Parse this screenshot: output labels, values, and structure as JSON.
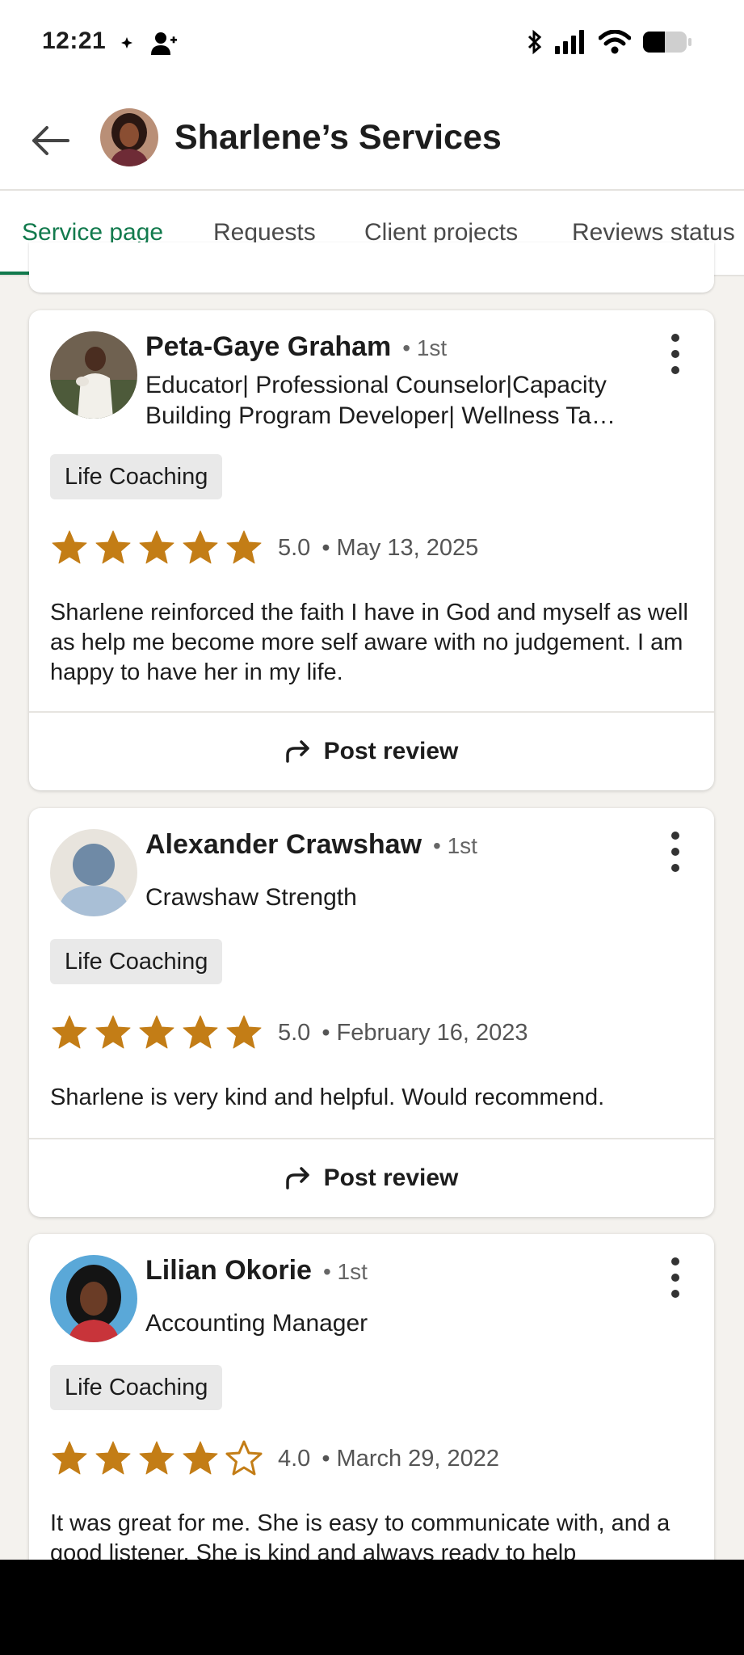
{
  "status_bar": {
    "time": "12:21",
    "left_icons": [
      "location-arrow-icon",
      "person-add-icon"
    ],
    "right_icons": [
      "bluetooth-icon",
      "cellular-signal-icon",
      "wifi-icon",
      "battery-icon"
    ]
  },
  "header": {
    "title": "Sharlene’s Services",
    "back_icon": "back-arrow-icon"
  },
  "tabs": [
    {
      "label": "Service page",
      "active": true
    },
    {
      "label": "Requests",
      "active": false
    },
    {
      "label": "Client projects",
      "active": false
    },
    {
      "label": "Reviews status",
      "active": false
    }
  ],
  "colors": {
    "accent": "#127a4d",
    "star": "#c37d16",
    "page_background": "#f4f2ee"
  },
  "reviews": [
    {
      "name": "Peta-Gaye Graham",
      "degree": "• 1st",
      "headline_line1": "Educator| Professional Counselor|Capacity",
      "headline_line2": "Building Program Developer| Wellness Ta…",
      "service_tag": "Life Coaching",
      "rating": 5,
      "rating_text": "5.0",
      "date": "• May 13, 2025",
      "text": "Sharlene reinforced the faith I have in God and myself as well as help me become more self aware with no judgement. I am happy to have her in my life.",
      "action_label": "Post review"
    },
    {
      "name": "Alexander Crawshaw",
      "degree": "• 1st",
      "headline_line1": "Crawshaw Strength",
      "service_tag": "Life Coaching",
      "rating": 5,
      "rating_text": "5.0",
      "date": "• February 16, 2023",
      "text": "Sharlene is very kind and helpful. Would recommend.",
      "action_label": "Post review"
    },
    {
      "name": "Lilian Okorie",
      "degree": "• 1st",
      "headline_line1": "Accounting Manager",
      "service_tag": "Life Coaching",
      "rating": 4,
      "rating_text": "4.0",
      "date": "• March 29, 2022",
      "text": "It was great for me. She is easy to communicate with, and a good listener. She is kind and always ready to help"
    }
  ]
}
